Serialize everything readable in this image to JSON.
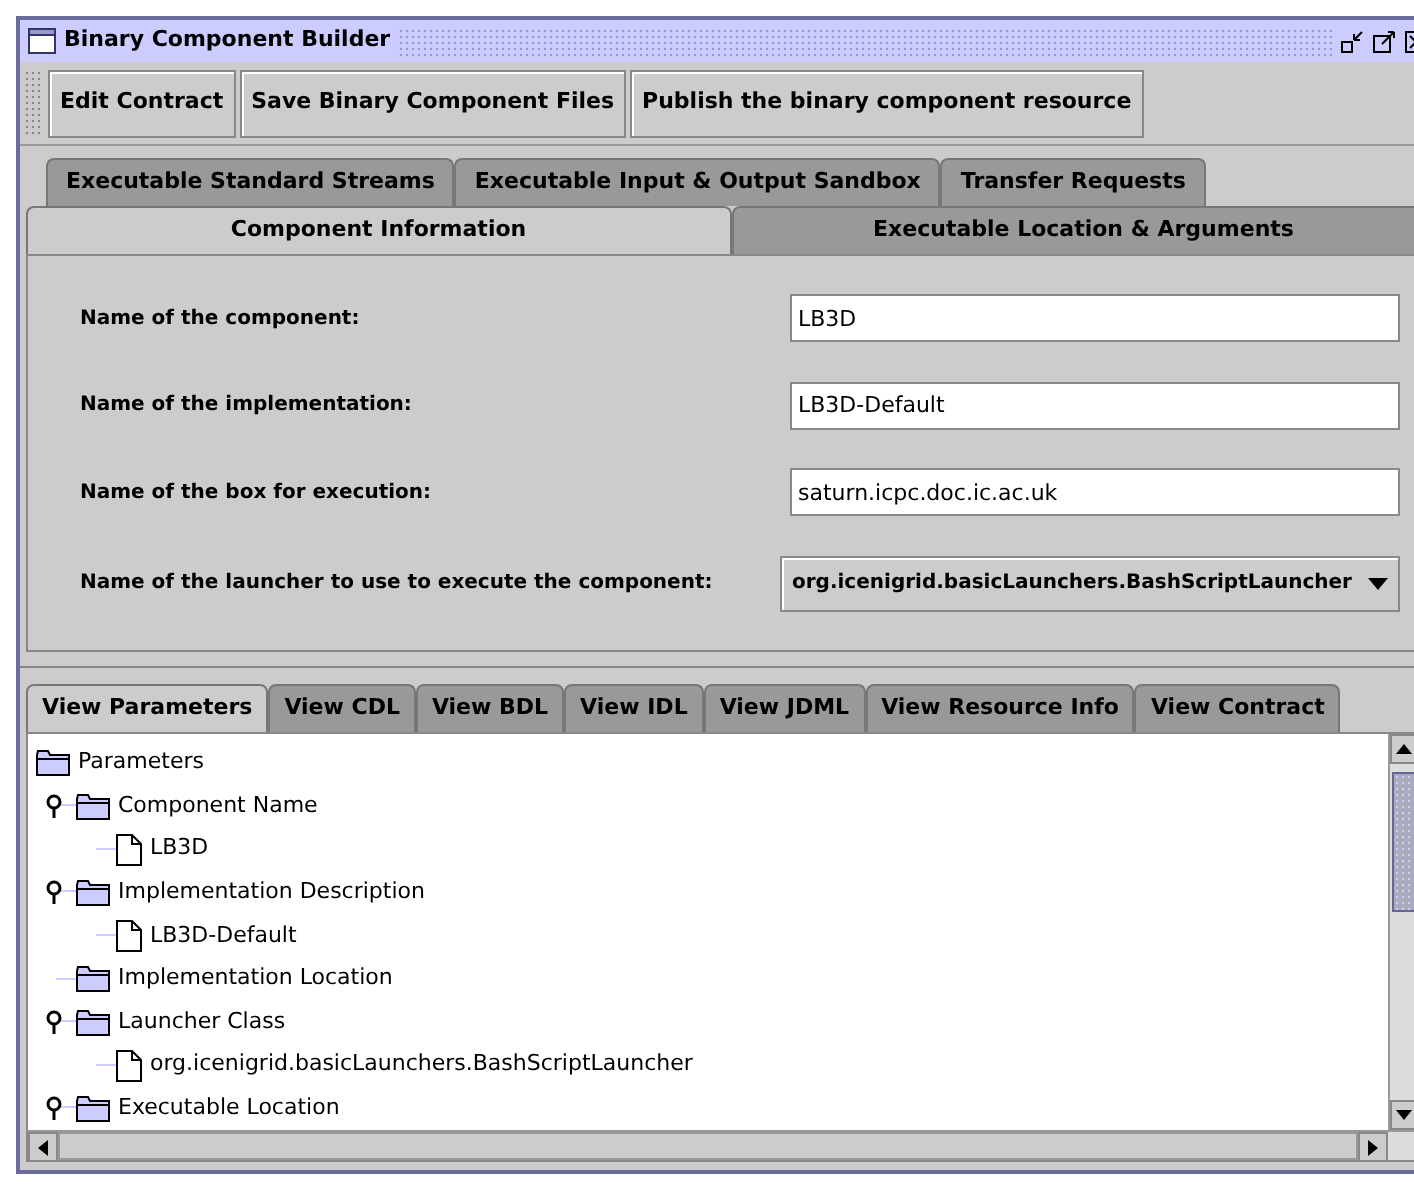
{
  "window": {
    "title": "Binary Component Builder"
  },
  "toolbar": {
    "buttons": [
      "Edit Contract",
      "Save Binary Component Files",
      "Publish the binary component resource"
    ]
  },
  "tab_rows": [
    [
      {
        "label": "Executable Standard Streams",
        "selected": false
      },
      {
        "label": "Executable Input & Output Sandbox",
        "selected": false
      },
      {
        "label": "Transfer Requests",
        "selected": false
      }
    ],
    [
      {
        "label": "Component Information",
        "selected": true
      },
      {
        "label": "Executable Location & Arguments",
        "selected": false
      }
    ]
  ],
  "form": {
    "fields": [
      {
        "kind": "text",
        "label": "Name of the component:",
        "value": "LB3D"
      },
      {
        "kind": "text",
        "label": "Name of the implementation:",
        "value": "LB3D-Default"
      },
      {
        "kind": "text",
        "label": "Name of the box for execution:",
        "value": "saturn.icpc.doc.ic.ac.uk"
      },
      {
        "kind": "dropdown",
        "label": "Name of the launcher to use to execute the component:",
        "value": "org.icenigrid.basicLaunchers.BashScriptLauncher"
      }
    ]
  },
  "view_tabs": [
    {
      "label": "View Parameters",
      "selected": true
    },
    {
      "label": "View CDL",
      "selected": false
    },
    {
      "label": "View BDL",
      "selected": false
    },
    {
      "label": "View IDL",
      "selected": false
    },
    {
      "label": "View JDML",
      "selected": false
    },
    {
      "label": "View Resource Info",
      "selected": false
    },
    {
      "label": "View Contract",
      "selected": false
    }
  ],
  "tree": {
    "label": "Parameters",
    "kind": "folder",
    "children": [
      {
        "label": "Component Name",
        "kind": "folder",
        "expanded": true,
        "children": [
          {
            "label": "LB3D",
            "kind": "file"
          }
        ]
      },
      {
        "label": "Implementation Description",
        "kind": "folder",
        "expanded": true,
        "children": [
          {
            "label": "LB3D-Default",
            "kind": "file"
          }
        ]
      },
      {
        "label": "Implementation Location",
        "kind": "folder"
      },
      {
        "label": "Launcher Class",
        "kind": "folder",
        "expanded": true,
        "children": [
          {
            "label": "org.icenigrid.basicLaunchers.BashScriptLauncher",
            "kind": "file"
          }
        ]
      },
      {
        "label": "Executable Location",
        "kind": "folder",
        "expanded": true
      }
    ]
  }
}
